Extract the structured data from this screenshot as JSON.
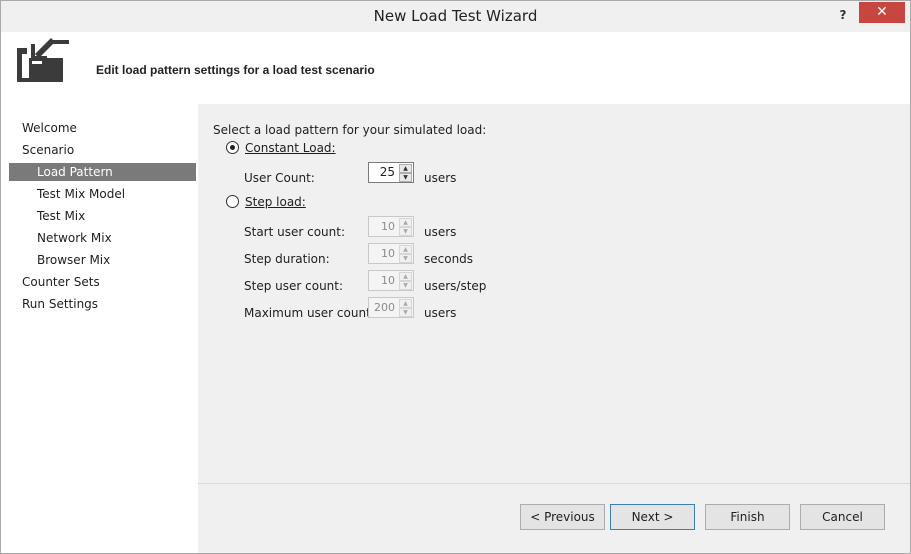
{
  "window": {
    "title": "New Load Test Wizard",
    "help_glyph": "?",
    "close_glyph": "✕"
  },
  "header": {
    "text": "Edit load pattern settings for a load test scenario",
    "icon": "wizard-import-arrow-icon"
  },
  "sidebar": {
    "items": [
      {
        "label": "Welcome",
        "level": 1,
        "selected": false
      },
      {
        "label": "Scenario",
        "level": 1,
        "selected": false
      },
      {
        "label": "Load Pattern",
        "level": 2,
        "selected": true
      },
      {
        "label": "Test Mix Model",
        "level": 2,
        "selected": false
      },
      {
        "label": "Test Mix",
        "level": 2,
        "selected": false
      },
      {
        "label": "Network Mix",
        "level": 2,
        "selected": false
      },
      {
        "label": "Browser Mix",
        "level": 2,
        "selected": false
      },
      {
        "label": "Counter Sets",
        "level": 1,
        "selected": false
      },
      {
        "label": "Run Settings",
        "level": 1,
        "selected": false
      }
    ]
  },
  "content": {
    "prompt": "Select a load pattern for your simulated load:",
    "constant": {
      "radio_label": "Constant Load:",
      "selected": true,
      "user_count_label": "User Count:",
      "user_count_value": "25",
      "user_count_unit": "users"
    },
    "step": {
      "radio_label": "Step load:",
      "selected": false,
      "start_label": "Start user count:",
      "start_value": "10",
      "start_unit": "users",
      "duration_label": "Step duration:",
      "duration_value": "10",
      "duration_unit": "seconds",
      "step_count_label": "Step user count:",
      "step_count_value": "10",
      "step_count_unit": "users/step",
      "max_label": "Maximum user count:",
      "max_value": "200",
      "max_unit": "users"
    }
  },
  "buttons": {
    "previous": "< Previous",
    "next": "Next >",
    "finish": "Finish",
    "cancel": "Cancel"
  },
  "colors": {
    "selected_nav_bg": "#7a7a7a",
    "close_button_bg": "#c7463f",
    "default_button_border": "#3c7fb1"
  }
}
